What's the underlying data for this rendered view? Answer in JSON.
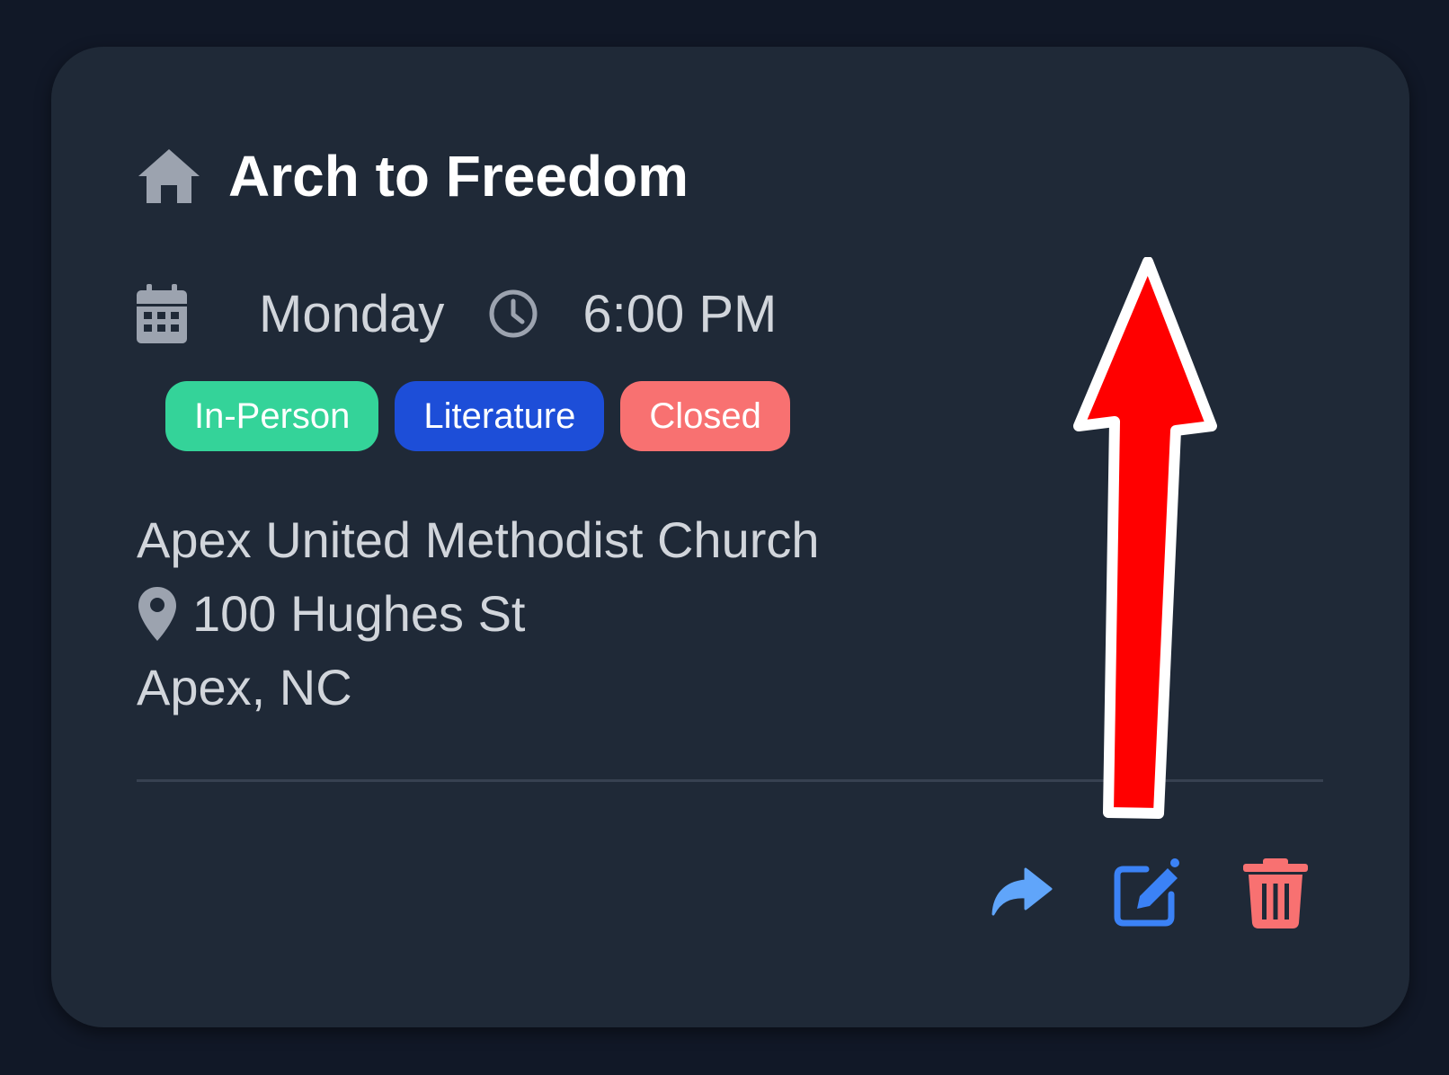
{
  "meeting": {
    "title": "Arch to Freedom",
    "day": "Monday",
    "time": "6:00 PM",
    "badges": [
      {
        "label": "In-Person",
        "color": "#34d399"
      },
      {
        "label": "Literature",
        "color": "#1d4ed8"
      },
      {
        "label": "Closed",
        "color": "#f87171"
      }
    ],
    "location_name": "Apex United Methodist Church",
    "street": "100 Hughes St",
    "city_state": "Apex, NC"
  },
  "icons": {
    "title": "home-icon",
    "day": "calendar-icon",
    "time": "clock-icon",
    "street": "map-pin-icon",
    "actions": [
      "share-icon",
      "edit-icon",
      "trash-icon"
    ]
  },
  "colors": {
    "background": "#111827",
    "card": "#1f2937",
    "share": "#60a5fa",
    "edit": "#3b82f6",
    "delete": "#f87171",
    "annotation_arrow": "#ff0000"
  }
}
